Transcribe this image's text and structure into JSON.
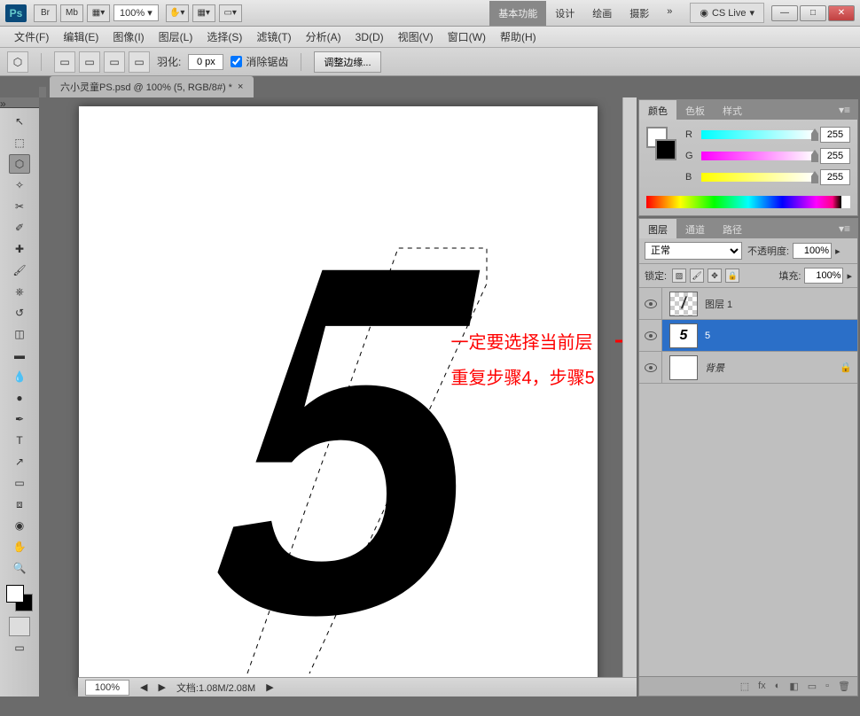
{
  "titlebar": {
    "logo": "Ps",
    "br": "Br",
    "mb": "Mb",
    "zoom": "100%",
    "tabs": [
      "基本功能",
      "设计",
      "绘画",
      "摄影"
    ],
    "more": "»",
    "cslive": "CS Live",
    "min": "—",
    "max": "□",
    "close": "✕"
  },
  "menubar": [
    "文件(F)",
    "编辑(E)",
    "图像(I)",
    "图层(L)",
    "选择(S)",
    "滤镜(T)",
    "分析(A)",
    "3D(D)",
    "视图(V)",
    "窗口(W)",
    "帮助(H)"
  ],
  "optbar": {
    "feather_label": "羽化:",
    "feather_value": "0 px",
    "antialias": "消除锯齿",
    "refine": "调整边缘..."
  },
  "doctab": {
    "title": "六小灵童PS.psd @ 100% (5, RGB/8#) *",
    "close": "×"
  },
  "annotations": {
    "line1": "一定要选择当前层",
    "line2": "重复步骤4，步骤5"
  },
  "color_panel": {
    "tabs": [
      "颜色",
      "色板",
      "样式"
    ],
    "r_label": "R",
    "r_val": "255",
    "g_label": "G",
    "g_val": "255",
    "b_label": "B",
    "b_val": "255"
  },
  "layers_panel": {
    "tabs": [
      "图层",
      "通道",
      "路径"
    ],
    "blend": "正常",
    "opacity_label": "不透明度:",
    "opacity_val": "100%",
    "lock_label": "锁定:",
    "fill_label": "填充:",
    "fill_val": "100%",
    "layers": [
      {
        "name": "图层 1",
        "thumb": "/",
        "checker": true
      },
      {
        "name": "5",
        "thumb": "5",
        "selected": true
      },
      {
        "name": "背景",
        "thumb": "",
        "locked": true
      }
    ],
    "footer_icons": [
      "⬚",
      "fx",
      "◐",
      "◧",
      "▭",
      "▫",
      "🗑"
    ]
  },
  "statusbar": {
    "zoom": "100%",
    "doc": "文档:1.08M/2.08M"
  }
}
